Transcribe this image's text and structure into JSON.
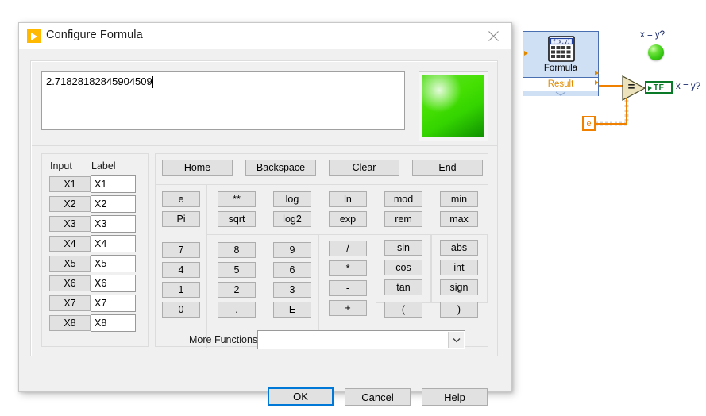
{
  "dialog": {
    "title": "Configure Formula",
    "icon": "labview-run-icon",
    "close_label": "close-icon",
    "formula_value": "2.71828182845904509",
    "validity_color": "#46e003",
    "columns": {
      "input": "Input",
      "label": "Label"
    },
    "inputs": [
      {
        "button": "X1",
        "label": "X1"
      },
      {
        "button": "X2",
        "label": "X2"
      },
      {
        "button": "X3",
        "label": "X3"
      },
      {
        "button": "X4",
        "label": "X4"
      },
      {
        "button": "X5",
        "label": "X5"
      },
      {
        "button": "X6",
        "label": "X6"
      },
      {
        "button": "X7",
        "label": "X7"
      },
      {
        "button": "X8",
        "label": "X8"
      }
    ],
    "edit_buttons": [
      "Home",
      "Backspace",
      "Clear",
      "End"
    ],
    "const_buttons": [
      "e",
      "Pi"
    ],
    "math_buttons": [
      [
        "**",
        "log",
        "ln",
        "mod",
        "min"
      ],
      [
        "sqrt",
        "log2",
        "exp",
        "rem",
        "max"
      ]
    ],
    "numpad": [
      [
        "7",
        "8",
        "9"
      ],
      [
        "4",
        "5",
        "6"
      ],
      [
        "1",
        "2",
        "3"
      ],
      [
        "0",
        ".",
        "E"
      ]
    ],
    "operators": [
      "/",
      "*",
      "-",
      "+"
    ],
    "trig_buttons": [
      "sin",
      "cos",
      "tan"
    ],
    "misc_buttons": [
      "abs",
      "int",
      "sign"
    ],
    "paren_buttons": [
      "(",
      ")"
    ],
    "more_functions": {
      "label": "More Functions",
      "value": "",
      "placeholder": ""
    },
    "actions": {
      "ok": "OK",
      "cancel": "Cancel",
      "help": "Help"
    }
  },
  "diagram": {
    "formula_node": {
      "title": "Formula",
      "output_label": "Result",
      "icon": "calculator-icon",
      "icon_display": "f(x,y)"
    },
    "compare_node": {
      "operator": "=",
      "name": "equal-comparison"
    },
    "constant": {
      "value": "e"
    },
    "led": {
      "label": "x = y?",
      "state": "on",
      "color": "#3ccc16"
    },
    "boolean_indicator": {
      "text": "TF",
      "caption": "x = y?",
      "color": "#0a7a28"
    }
  }
}
